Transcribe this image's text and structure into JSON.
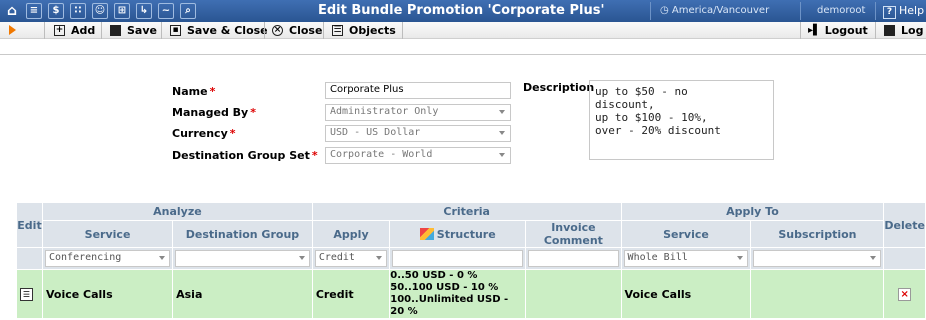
{
  "header": {
    "title": "Edit Bundle Promotion 'Corporate Plus'",
    "timezone": "America/Vancouver",
    "user": "demoroot",
    "help": "Help",
    "nav_icons": [
      "home-icon",
      "list-icon",
      "dollar-icon",
      "grid-icon",
      "person-icon",
      "tree-icon",
      "flow-icon",
      "chart-icon",
      "search-icon"
    ]
  },
  "toolbar": {
    "add": "Add",
    "save": "Save",
    "save_close": "Save & Close",
    "close": "Close",
    "objects": "Objects",
    "logout": "Logout",
    "log": "Log"
  },
  "form": {
    "name_label": "Name",
    "name_value": "Corporate Plus",
    "managed_label": "Managed By",
    "managed_value": "Administrator Only",
    "currency_label": "Currency",
    "currency_value": "USD - US Dollar",
    "dgs_label": "Destination Group Set",
    "dgs_value": "Corporate - World",
    "desc_label": "Description",
    "desc_value": "up to $50 - no\ndiscount,\nup to $100 - 10%,\nover - 20% discount"
  },
  "grid": {
    "groups": {
      "edit": "Edit",
      "analyze": "Analyze",
      "criteria": "Criteria",
      "apply_to": "Apply To",
      "delete": "Delete"
    },
    "columns": {
      "service": "Service",
      "destination_group": "Destination Group",
      "apply": "Apply",
      "structure": "Structure",
      "invoice_comment": "Invoice Comment",
      "apply_service": "Service",
      "subscription": "Subscription"
    },
    "filters": {
      "service": "Conferencing",
      "destination_group": "",
      "apply": "Credit",
      "structure": "",
      "invoice_comment": "",
      "apply_service": "Whole Bill",
      "subscription": ""
    },
    "rows": [
      {
        "service": "Voice Calls",
        "destination_group": "Asia",
        "apply": "Credit",
        "structure": [
          "0..50 USD - 0 %",
          "50..100 USD - 10 %",
          "100..Unlimited USD - 20 %"
        ],
        "invoice_comment": "",
        "apply_service": "Voice Calls",
        "subscription": ""
      }
    ]
  },
  "colors": {
    "header_bg": "#2f5e9e",
    "row_bg": "#cbeec4",
    "grid_header_bg": "#dde3ea",
    "required": "#dd0000"
  }
}
